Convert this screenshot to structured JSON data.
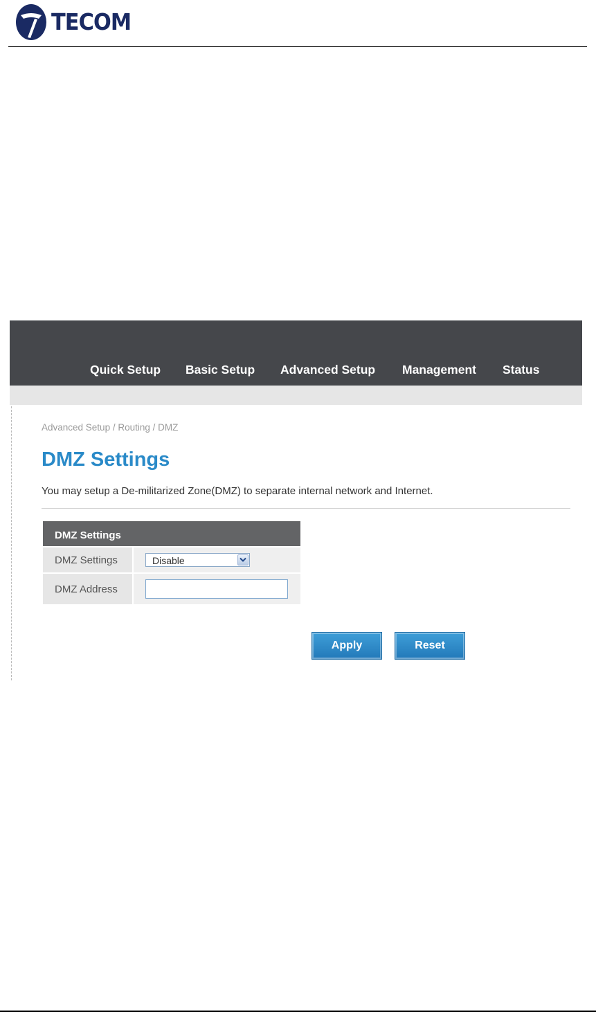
{
  "document": {
    "logo_text": "TECOM",
    "logo_icon": "tecom-logo-icon"
  },
  "nav": {
    "items": [
      {
        "label": "Quick Setup"
      },
      {
        "label": "Basic Setup"
      },
      {
        "label": "Advanced Setup"
      },
      {
        "label": "Management"
      },
      {
        "label": "Status"
      }
    ]
  },
  "page": {
    "breadcrumb": "Advanced Setup / Routing / DMZ",
    "title": "DMZ Settings",
    "description": "You may setup a De-militarized Zone(DMZ) to separate internal network and Internet."
  },
  "form": {
    "section_title": "DMZ Settings",
    "dmz_settings_label": "DMZ Settings",
    "dmz_settings_value": "Disable",
    "dmz_settings_icon": "chevron-down-icon",
    "dmz_address_label": "DMZ Address",
    "dmz_address_value": ""
  },
  "buttons": {
    "apply": "Apply",
    "reset": "Reset"
  },
  "colors": {
    "navbar": "#45474b",
    "title": "#2a8ac8",
    "button": "#2a87c8",
    "table_header": "#636466"
  }
}
